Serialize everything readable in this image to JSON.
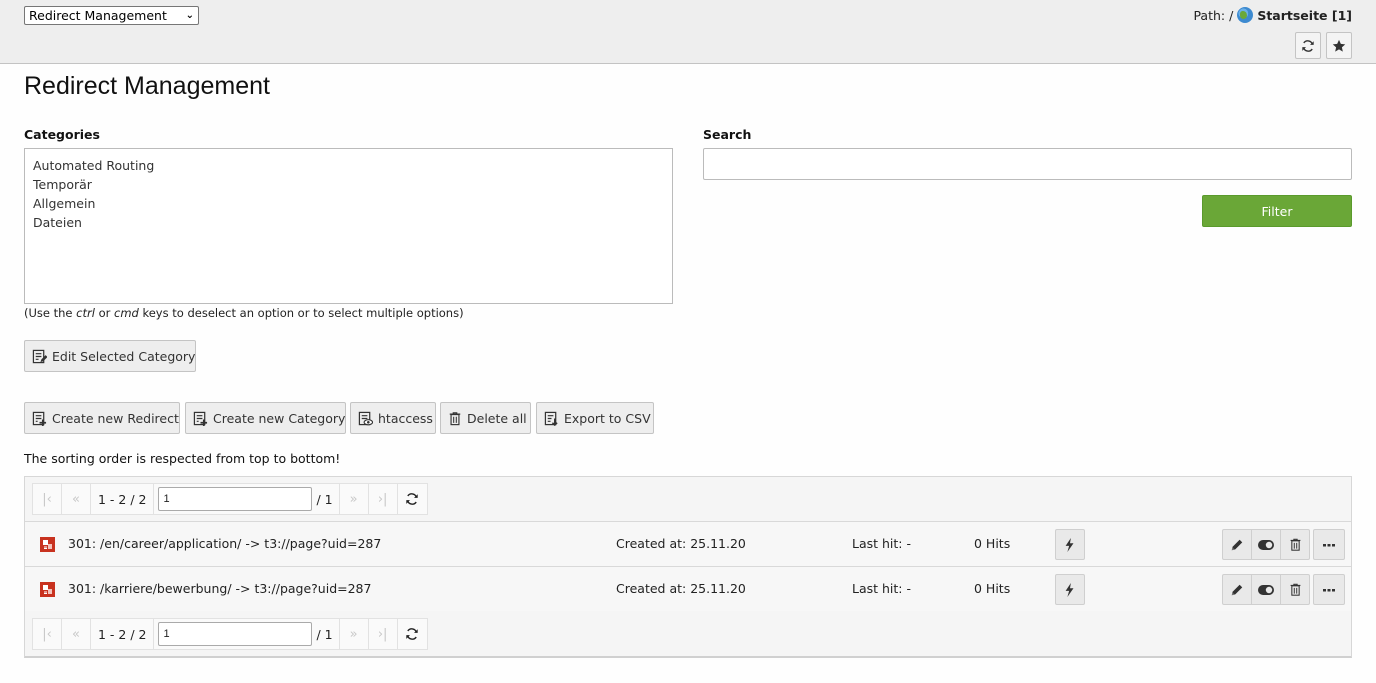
{
  "header": {
    "module_select": "Redirect Management",
    "path_label": "Path: /",
    "page_title": "Startseite [1]",
    "icons": {
      "refresh": "refresh-icon",
      "bookmark": "star-icon",
      "globe": "globe-icon"
    }
  },
  "main": {
    "title": "Redirect Management",
    "categories": {
      "label": "Categories",
      "options": [
        "Automated Routing",
        "Temporär",
        "Allgemein",
        "Dateien"
      ],
      "hint_pre": "(Use the ",
      "hint_key1": "ctrl",
      "hint_mid": " or ",
      "hint_key2": "cmd",
      "hint_post": " keys to deselect an option or to select multiple options)",
      "edit_button": "Edit Selected Category"
    },
    "search": {
      "label": "Search",
      "value": "",
      "placeholder": "",
      "filter_button": "Filter"
    },
    "toolbar": {
      "create_redirect": "Create new Redirect",
      "create_category": "Create new Category",
      "htaccess": "htaccess",
      "delete_all": "Delete all",
      "export_csv": "Export to CSV"
    },
    "sort_note": "The sorting order is respected from top to bottom!",
    "pagination": {
      "range": "1 - 2 / 2",
      "page_value": "1",
      "total_pages": "/ 1"
    },
    "redirects": [
      {
        "text": "301: /en/career/application/ -> t3://page?uid=287",
        "created": "Created at: 25.11.20",
        "last_hit": "Last hit: -",
        "hits": "0 Hits"
      },
      {
        "text": "301: /karriere/bewerbung/ -> t3://page?uid=287",
        "created": "Created at: 25.11.20",
        "last_hit": "Last hit: -",
        "hits": "0 Hits"
      }
    ]
  },
  "colors": {
    "accent_green": "#6aa737",
    "redirect_icon": "#c8321f",
    "header_bg": "#eeeeee"
  }
}
